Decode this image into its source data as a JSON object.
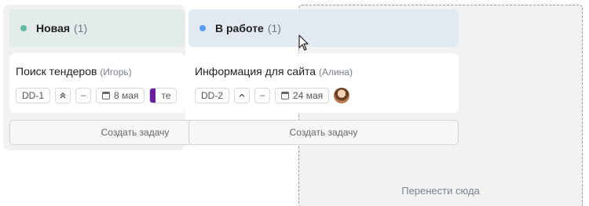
{
  "columns": [
    {
      "title": "Новая",
      "count": "(1)",
      "dot_color": "#5fb8a2",
      "create_label": "Создать задачу",
      "card": {
        "title": "Поиск тендеров",
        "assignee": "(Игорь)",
        "id": "DD-1",
        "priority_icon": "double-chevron-up-icon",
        "status": "–",
        "date": "8 мая",
        "tag_label": "те",
        "tag_color": "#6a1fa0"
      }
    },
    {
      "title": "В работе",
      "count": "(1)",
      "dot_color": "#5b9ef0",
      "create_label": "Создать задачу",
      "card": {
        "title": "Информация для сайта",
        "assignee": "(Алина)",
        "id": "DD-2",
        "priority_icon": "chevron-up-icon",
        "status": "–",
        "date": "24 мая",
        "avatar": "avatar-icon"
      }
    }
  ],
  "drop_zone": {
    "label": "Перенести сюда"
  }
}
